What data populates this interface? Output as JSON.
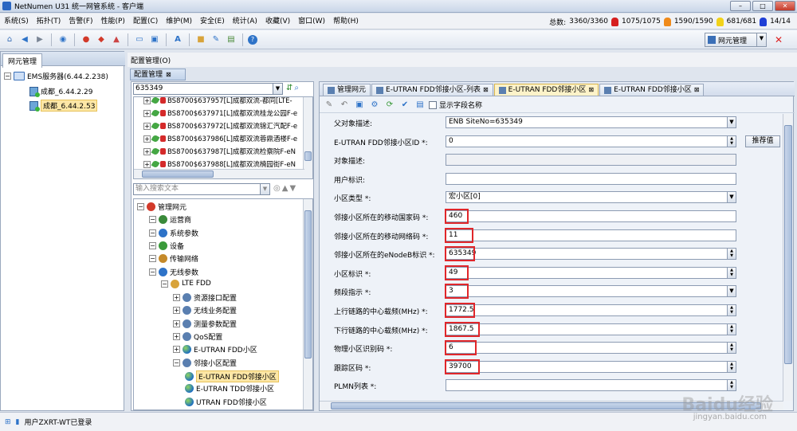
{
  "window": {
    "title": "NetNumen U31 统一网管系统 - 客户端"
  },
  "menu": [
    "系统(S)",
    "拓扑(T)",
    "告警(F)",
    "性能(P)",
    "配置(C)",
    "维护(M)",
    "安全(E)",
    "统计(A)",
    "收藏(V)",
    "窗口(W)",
    "帮助(H)"
  ],
  "stats": {
    "total_label": "总数:",
    "total": "3360/3360",
    "critical": "1075/1075",
    "major": "1590/1590",
    "minor": "681/681",
    "warning": "14/14",
    "colors": {
      "critical": "#d61f1f",
      "major": "#f08a1a",
      "minor": "#f2d21a",
      "warning": "#1f3fd6"
    }
  },
  "toolbar": {
    "netmgr_label": "网元管理"
  },
  "left_panel": {
    "tab": "网元管理",
    "root": "EMS服务器(6.44.2.238)",
    "nodes": [
      "成都_6.44.2.29",
      "成都_6.44.2.53"
    ]
  },
  "breadcrumb": "配置管理(O)",
  "config_tab": "配置管理",
  "search": {
    "value": "635349",
    "placeholder": "输入搜索文本"
  },
  "ne_list": [
    "BS8700$637957[L]成都双流-都同[LTE-",
    "BS8700$637971[L]成都双流桂龙公园F-e",
    "BS8700$637972[L]成都双流锦汇汽配F-e",
    "BS8700$637986[L]成都双流蓉鼎酒楼F-e",
    "BS8700$637987[L]成都双流检察院F-eN",
    "BS8700$637988[L]成都双流楠园街F-eN"
  ],
  "tree": [
    {
      "label": "管理网元",
      "indent": 0,
      "icon": "managed-ne"
    },
    {
      "label": "运营商",
      "indent": 1,
      "icon": "operator"
    },
    {
      "label": "系统参数",
      "indent": 1,
      "icon": "system-param"
    },
    {
      "label": "设备",
      "indent": 1,
      "icon": "device"
    },
    {
      "label": "传输网络",
      "indent": 1,
      "icon": "transport"
    },
    {
      "label": "无线参数",
      "indent": 1,
      "icon": "wireless"
    },
    {
      "label": "LTE FDD",
      "indent": 2,
      "icon": "lte"
    },
    {
      "label": "资源接口配置",
      "indent": 3,
      "icon": "config"
    },
    {
      "label": "无线业务配置",
      "indent": 3,
      "icon": "config"
    },
    {
      "label": "测量参数配置",
      "indent": 3,
      "icon": "config"
    },
    {
      "label": "QoS配置",
      "indent": 3,
      "icon": "config"
    },
    {
      "label": "E-UTRAN FDD小区",
      "indent": 3,
      "icon": "globe"
    },
    {
      "label": "邻接小区配置",
      "indent": 3,
      "icon": "config"
    },
    {
      "label": "E-UTRAN FDD邻接小区",
      "indent": 4,
      "icon": "globe",
      "selected": true
    },
    {
      "label": "E-UTRAN TDD邻接小区",
      "indent": 4,
      "icon": "globe"
    },
    {
      "label": "UTRAN FDD邻接小区",
      "indent": 4,
      "icon": "globe"
    },
    {
      "label": "UTRAN TDD邻接小区",
      "indent": 4,
      "icon": "globe"
    }
  ],
  "right_tabs": [
    {
      "label": "管理网元",
      "active": false
    },
    {
      "label": "E-UTRAN FDD邻接小区-列表",
      "active": false
    },
    {
      "label": "E-UTRAN FDD邻接小区",
      "active": true
    },
    {
      "label": "E-UTRAN FDD邻接小区",
      "active": false
    }
  ],
  "show_field_names": "显示字段名称",
  "recommend_label": "推荐值",
  "form": [
    {
      "label": "父对象描述:",
      "value": "ENB SiteNo=635349",
      "kind": "select",
      "width": 365
    },
    {
      "label": "E-UTRAN FDD邻接小区ID *:",
      "value": "0",
      "kind": "spin",
      "width": 365,
      "recommend": true
    },
    {
      "label": "对象描述:",
      "value": "",
      "kind": "readonly",
      "width": 365
    },
    {
      "label": "用户标识:",
      "value": "",
      "kind": "text",
      "width": 365
    },
    {
      "label": "小区类型 *:",
      "value": "宏小区[0]",
      "kind": "select",
      "width": 365
    },
    {
      "label": "邻接小区所在的移动国家码 *:",
      "value": "460",
      "kind": "text",
      "width": 365,
      "highlight": 30
    },
    {
      "label": "邻接小区所在的移动网络码 *:",
      "value": "11",
      "kind": "text",
      "width": 365,
      "highlight": 36
    },
    {
      "label": "邻接小区所在的eNodeB标识 *:",
      "value": "635349",
      "kind": "spin",
      "width": 365,
      "highlight": 38
    },
    {
      "label": "小区标识 *:",
      "value": "49",
      "kind": "spin",
      "width": 365,
      "highlight": 30
    },
    {
      "label": "频段指示 *:",
      "value": "3",
      "kind": "select",
      "width": 365,
      "highlight": 30
    },
    {
      "label": "上行链路的中心载频(MHz) *:",
      "value": "1772.5",
      "kind": "spin",
      "width": 365,
      "highlight": 38
    },
    {
      "label": "下行链路的中心载频(MHz) *:",
      "value": "1867.5",
      "kind": "spin",
      "width": 365,
      "highlight": 44
    },
    {
      "label": "物理小区识别码 *:",
      "value": "6",
      "kind": "spin",
      "width": 365,
      "highlight": 40
    },
    {
      "label": "跟踪区码 *:",
      "value": "39700",
      "kind": "spin",
      "width": 365,
      "highlight": 44
    },
    {
      "label": "PLMN列表 *:",
      "value": "",
      "kind": "spin",
      "width": 365
    }
  ],
  "status": {
    "user": "用户ZXRT-WT已登录"
  },
  "watermark": {
    "text": "Baidu经验",
    "sub": "jingyan.baidu.com"
  }
}
